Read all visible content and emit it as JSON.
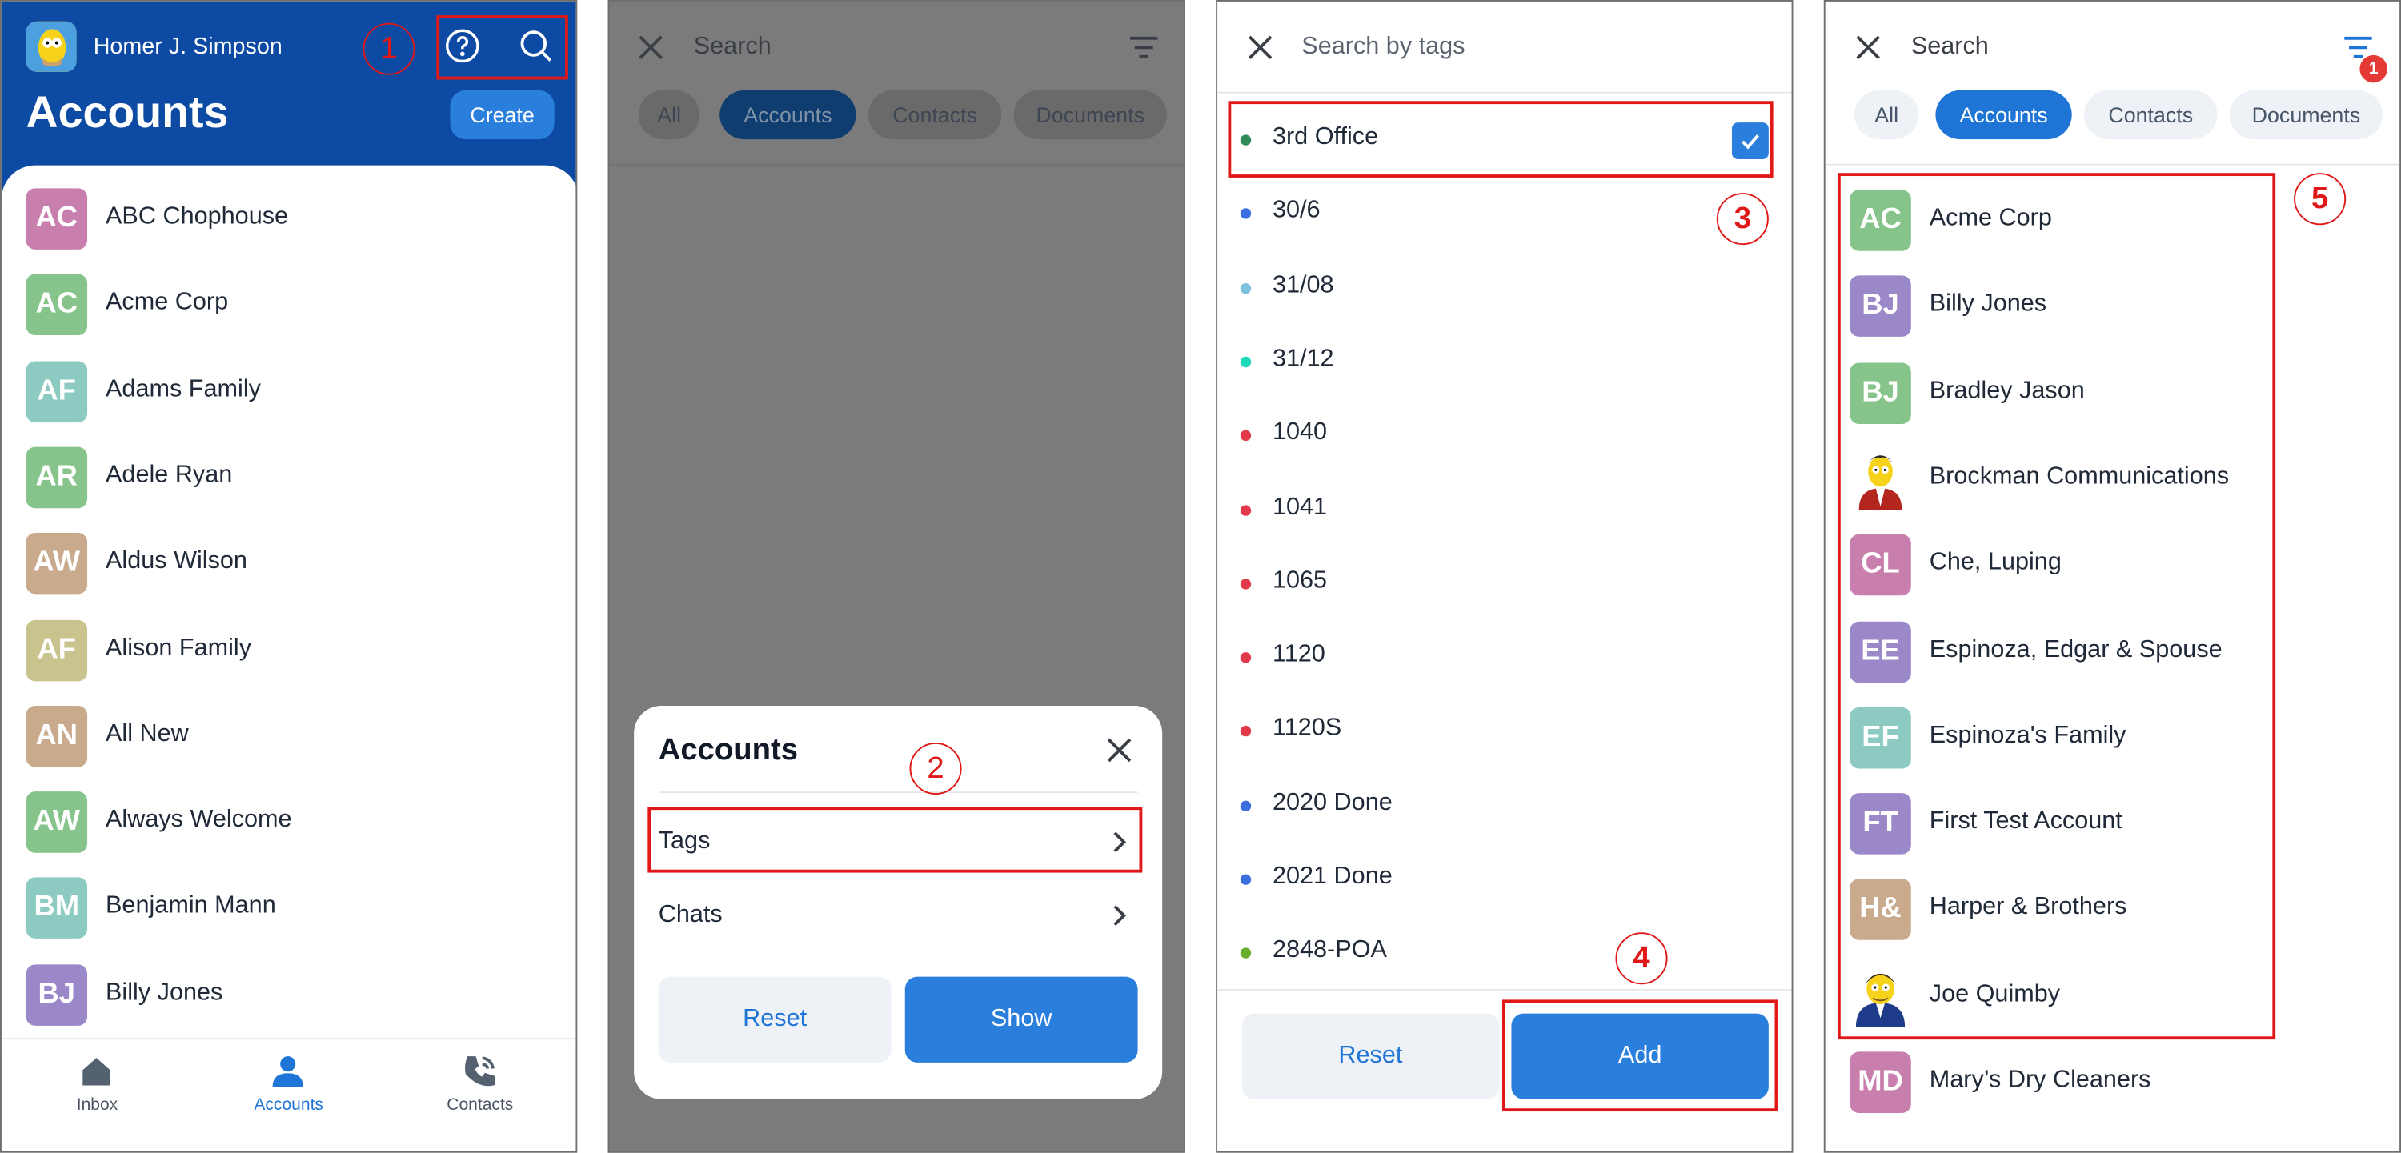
{
  "colors": {
    "brand_blue": "#0d4aa3",
    "primary_button": "#2b7fdc",
    "annotation_red": "#e01818"
  },
  "annotations": [
    "1",
    "2",
    "3",
    "4",
    "5"
  ],
  "panel1": {
    "user_name": "Homer J. Simpson",
    "title": "Accounts",
    "create_label": "Create",
    "accounts": [
      {
        "initials": "AC",
        "name": "ABC Chophouse",
        "color": "#c97fae"
      },
      {
        "initials": "AC",
        "name": "Acme Corp",
        "color": "#86c48c"
      },
      {
        "initials": "AF",
        "name": "Adams Family",
        "color": "#8ccac2"
      },
      {
        "initials": "AR",
        "name": "Adele Ryan",
        "color": "#86c48c"
      },
      {
        "initials": "AW",
        "name": "Aldus Wilson",
        "color": "#c9aa8d"
      },
      {
        "initials": "AF",
        "name": "Alison Family",
        "color": "#c9c48d"
      },
      {
        "initials": "AN",
        "name": "All New",
        "color": "#c9aa8d"
      },
      {
        "initials": "AW",
        "name": "Always Welcome",
        "color": "#86c48c"
      },
      {
        "initials": "BM",
        "name": "Benjamin Mann",
        "color": "#8ccac2"
      },
      {
        "initials": "BJ",
        "name": "Billy Jones",
        "color": "#9b88c9"
      }
    ],
    "tabs": [
      {
        "label": "Inbox",
        "icon": "home-icon"
      },
      {
        "label": "Accounts",
        "icon": "person-icon"
      },
      {
        "label": "Contacts",
        "icon": "phone-icon"
      }
    ]
  },
  "panel2": {
    "search_placeholder": "Search",
    "chips": [
      "All",
      "Accounts",
      "Contacts",
      "Documents"
    ],
    "sheet_title": "Accounts",
    "sheet_items": [
      "Tags",
      "Chats"
    ],
    "reset_label": "Reset",
    "show_label": "Show"
  },
  "panel3": {
    "search_placeholder": "Search by tags",
    "tags": [
      {
        "label": "3rd Office",
        "color": "#2e8b57",
        "checked": true
      },
      {
        "label": "30/6",
        "color": "#3b6fe0"
      },
      {
        "label": "31/08",
        "color": "#7ec2e0"
      },
      {
        "label": "31/12",
        "color": "#1ed9b5"
      },
      {
        "label": "1040",
        "color": "#e23a4a"
      },
      {
        "label": "1041",
        "color": "#e23a4a"
      },
      {
        "label": "1065",
        "color": "#e23a4a"
      },
      {
        "label": "1120",
        "color": "#e23a4a"
      },
      {
        "label": "1120S",
        "color": "#e23a4a"
      },
      {
        "label": "2020 Done",
        "color": "#3b6fe0"
      },
      {
        "label": "2021 Done",
        "color": "#3b6fe0"
      },
      {
        "label": "2848-POA",
        "color": "#6aae2e"
      }
    ],
    "reset_label": "Reset",
    "add_label": "Add"
  },
  "panel4": {
    "search_placeholder": "Search",
    "filter_count": "1",
    "chips": [
      "All",
      "Accounts",
      "Contacts",
      "Documents"
    ],
    "accounts": [
      {
        "initials": "AC",
        "name": "Acme Corp",
        "color": "#86c48c"
      },
      {
        "initials": "BJ",
        "name": "Billy Jones",
        "color": "#9b88c9"
      },
      {
        "initials": "BJ",
        "name": "Bradley Jason",
        "color": "#86c48c"
      },
      {
        "initials": "",
        "name": "Brockman Communications",
        "color": "#ffffff",
        "photo": "brockman"
      },
      {
        "initials": "CL",
        "name": "Che, Luping",
        "color": "#c97fae"
      },
      {
        "initials": "EE",
        "name": "Espinoza, Edgar & Spouse",
        "color": "#9b88c9"
      },
      {
        "initials": "EF",
        "name": "Espinoza's Family",
        "color": "#8ccac2"
      },
      {
        "initials": "FT",
        "name": "First Test Account",
        "color": "#9b88c9"
      },
      {
        "initials": "H&",
        "name": "Harper & Brothers",
        "color": "#c9aa8d"
      },
      {
        "initials": "",
        "name": "Joe Quimby",
        "color": "#ffffff",
        "photo": "quimby"
      },
      {
        "initials": "MD",
        "name": "Mary’s Dry Cleaners",
        "color": "#c97fae"
      }
    ]
  }
}
